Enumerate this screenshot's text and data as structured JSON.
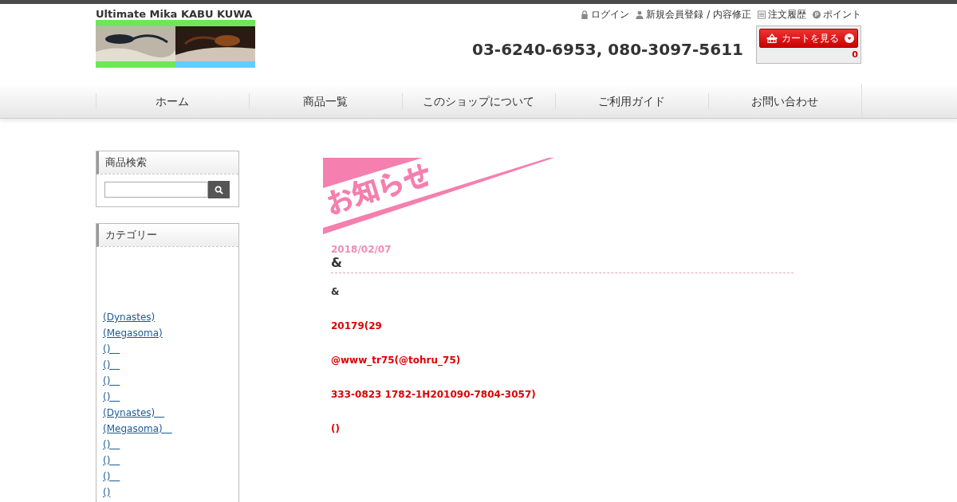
{
  "header": {
    "site_title": "Ultimate Mika KABU KUWA",
    "phone": "03-6240-6953, 080-3097-5611",
    "account_links": [
      {
        "kind": "lock",
        "label": "ログイン"
      },
      {
        "kind": "person",
        "label": "新規会員登録 / 内容修正"
      },
      {
        "kind": "list",
        "label": "注文履歴"
      },
      {
        "kind": "points",
        "label": "ポイント"
      }
    ],
    "cart": {
      "button": "カートを見る",
      "count": "0"
    }
  },
  "nav": [
    "ホーム",
    "商品一覧",
    "このショップについて",
    "ご利用ガイド",
    "お問い合わせ"
  ],
  "sidebar": {
    "search": {
      "title": "商品検索"
    },
    "categories": {
      "title": "カテゴリー",
      "items": [
        "(Dynastes)",
        "(Megasoma)",
        "()　",
        "()　",
        "()　",
        "()　",
        "(Dynastes)　",
        "(Megasoma)　",
        "()　",
        "()　",
        "()　",
        "()"
      ]
    }
  },
  "news": {
    "heading": "お知らせ",
    "date": "2018/02/07",
    "title": "&",
    "lines": [
      {
        "kind": "plain",
        "text": "&"
      },
      {
        "kind": "alert",
        "text": "20179(29"
      },
      {
        "kind": "alert",
        "text": "@www_tr75(@tohru_75)"
      },
      {
        "kind": "alert",
        "text": "333-0823 1782-1H201090-7804-3057)"
      },
      {
        "kind": "alert",
        "text": "()"
      }
    ]
  }
}
